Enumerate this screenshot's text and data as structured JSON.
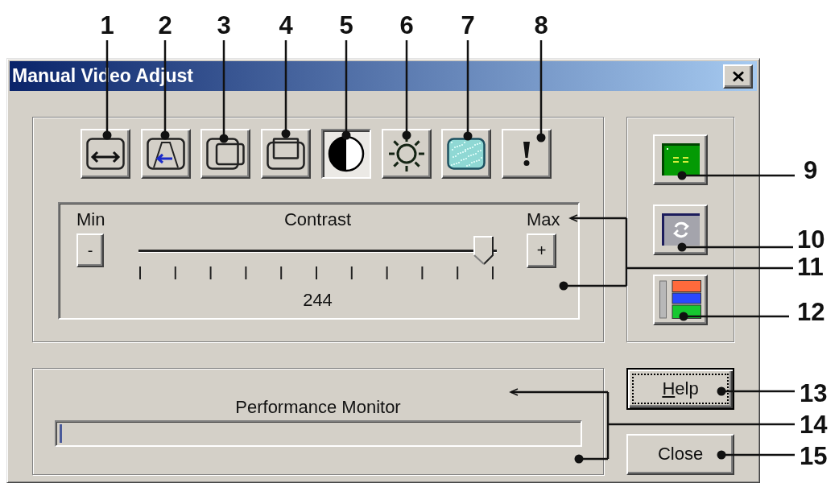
{
  "callouts": [
    {
      "label": "1"
    },
    {
      "label": "2"
    },
    {
      "label": "3"
    },
    {
      "label": "4"
    },
    {
      "label": "5"
    },
    {
      "label": "6"
    },
    {
      "label": "7"
    },
    {
      "label": "8"
    },
    {
      "label": "9"
    },
    {
      "label": "10"
    },
    {
      "label": "11"
    },
    {
      "label": "12"
    },
    {
      "label": "13"
    },
    {
      "label": "14"
    },
    {
      "label": "15"
    }
  ],
  "window": {
    "title": "Manual Video Adjust"
  },
  "toolbar": [
    {
      "selected": false
    },
    {
      "selected": false
    },
    {
      "selected": false
    },
    {
      "selected": false
    },
    {
      "selected": true
    },
    {
      "selected": false
    },
    {
      "selected": false
    },
    {
      "selected": false
    }
  ],
  "adjustment": {
    "min_label": "Min",
    "title": "Contrast",
    "max_label": "Max",
    "decrease_button": "-",
    "increase_button": "+",
    "level": 0.97,
    "value": "244"
  },
  "performance_monitor": {
    "label": "Performance Monitor",
    "level": 0.005
  },
  "buttons": [
    {
      "label": "Help",
      "mnemonic_underlined": true,
      "focused": true
    },
    {
      "label": "Close",
      "mnemonic_underlined": false,
      "focused": false
    }
  ]
}
